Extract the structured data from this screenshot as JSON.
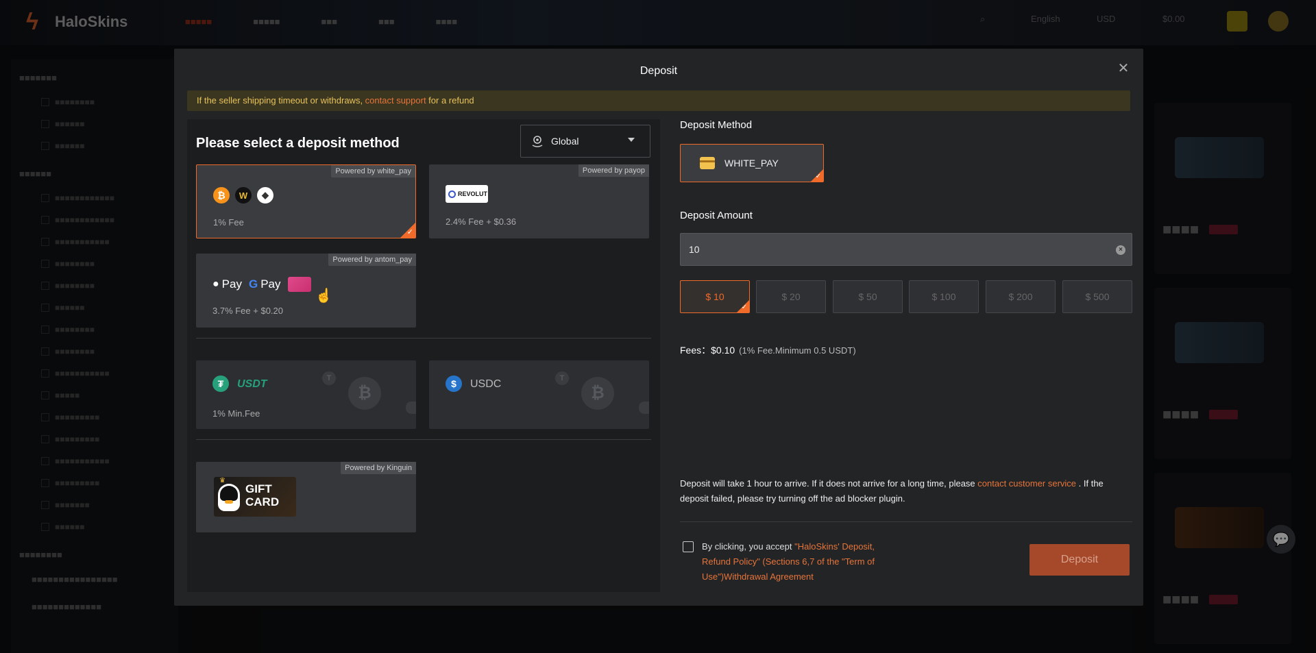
{
  "header": {
    "brand": "HaloSkins",
    "balance": "$0.00",
    "language": "English",
    "currency": "USD"
  },
  "modal": {
    "title": "Deposit",
    "notice": {
      "text_before": "If the seller shipping timeout or withdraws, ",
      "link": "contact support",
      "text_after": " for a refund"
    },
    "left": {
      "heading": "Please select a deposit method",
      "region": "Global",
      "methods": [
        {
          "name": "crypto-multi",
          "powered": "Powered by white_pay",
          "fee": "1% Fee",
          "selected": true
        },
        {
          "name": "revolut",
          "powered": "Powered by payop",
          "logo": "REVOLUT",
          "fee": "2.4% Fee + $0.36"
        },
        {
          "name": "applepay-googlepay",
          "powered": "Powered by antom_pay",
          "apple": "Pay",
          "google": "Pay",
          "fee": "3.7% Fee + $0.20"
        },
        {
          "name": "usdt",
          "label": "USDT",
          "fee": "1% Min.Fee"
        },
        {
          "name": "usdc",
          "label": "USDC"
        },
        {
          "name": "giftcard",
          "powered": "Powered by Kinguin",
          "label1": "GIFT",
          "label2": "CARD"
        }
      ]
    },
    "right": {
      "method_label": "Deposit Method",
      "method_value": "WHITE_PAY",
      "amount_label": "Deposit Amount",
      "amount_value": "10",
      "presets": [
        "$ 10",
        "$ 20",
        "$ 50",
        "$ 100",
        "$ 200",
        "$ 500"
      ],
      "fees_label": "Fees：",
      "fees_value": "$0.10",
      "fees_note": "(1% Fee.Minimum 0.5 USDT)",
      "info_before": "Deposit will take 1 hour to arrive. If it does not arrive for a long time, please ",
      "info_link": "contact customer service",
      "info_after": " . If the deposit failed, please try turning off the ad blocker plugin.",
      "agree_before": "By clicking, you accept ",
      "agree_link": "\"HaloSkins' Deposit, Refund Policy\" (Sections 6,7 of the \"Term of Use\")Withdrawal Agreement",
      "deposit_button": "Deposit"
    }
  },
  "colors": {
    "accent": "#f06a2a",
    "notice_bg": "#3b3620",
    "deposit_btn": "#a5492a"
  }
}
